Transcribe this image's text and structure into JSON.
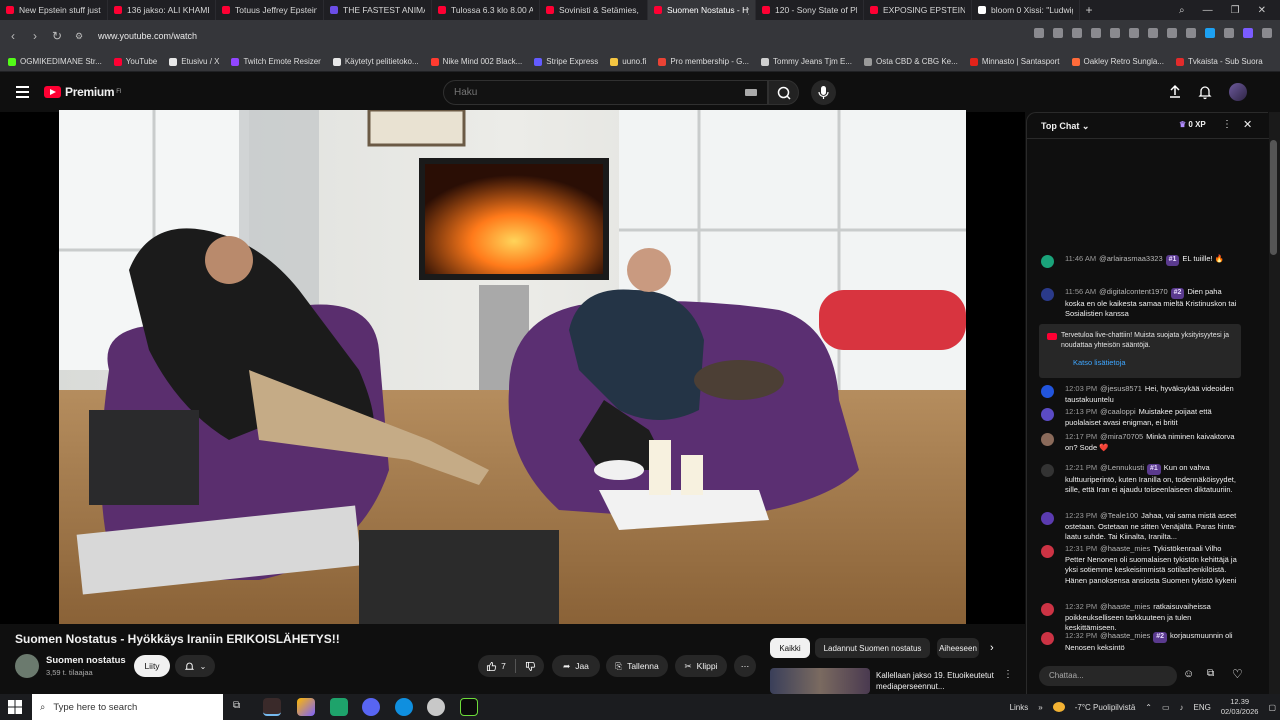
{
  "browser": {
    "tabs": [
      {
        "label": "New Epstein stuff just dr",
        "color": "#ff0033"
      },
      {
        "label": "136 jakso: ALI KHAMENE",
        "color": "#ff0033"
      },
      {
        "label": "Totuus Jeffrey Epsteinin",
        "color": "#ff0033"
      },
      {
        "label": "THE FASTEST ANIMATRO",
        "color": "#6b4de6"
      },
      {
        "label": "Tulossa 6.3 klo 8.00 Alek",
        "color": "#ff0033"
      },
      {
        "label": "Sovinisti & Setämies, jak",
        "color": "#ff0033"
      },
      {
        "label": "Suomen Nostatus - Hy",
        "color": "#ff0033",
        "active": true
      },
      {
        "label": "120 - Sony State of Play 2",
        "color": "#ff0033"
      },
      {
        "label": "EXPOSING EPSTEIN'S ZO",
        "color": "#ff0033"
      },
      {
        "label": "bloom 0 Xissi: \"Ludwig",
        "color": "#ffffff"
      }
    ],
    "url": "www.youtube.com/watch",
    "bookmarks": [
      {
        "label": "OGMIKEDIMANE Str...",
        "color": "#53fc18"
      },
      {
        "label": "YouTube",
        "color": "#ff0033"
      },
      {
        "label": "Etusivu / X",
        "color": "#e7e7e7"
      },
      {
        "label": "Twitch Emote Resizer",
        "color": "#9146ff"
      },
      {
        "label": "Käytetyt pelitietoko...",
        "color": "#e7e7e7"
      },
      {
        "label": "Nike Mind 002 Black...",
        "color": "#ff3b30"
      },
      {
        "label": "Stripe Express",
        "color": "#635bff"
      },
      {
        "label": "uuno.fi",
        "color": "#f4c542"
      },
      {
        "label": "Pro membership - G...",
        "color": "#ea4335"
      },
      {
        "label": "Tommy Jeans Tjm E...",
        "color": "#cfcfcf"
      },
      {
        "label": "Osta CBD & CBG Ke...",
        "color": "#9a9a9a"
      },
      {
        "label": "Minnasto | Santasport",
        "color": "#e2231a"
      },
      {
        "label": "Oakley Retro Sungla...",
        "color": "#ff6b3a"
      },
      {
        "label": "Tvkaista - Sub Suora",
        "color": "#e22b2b"
      }
    ]
  },
  "header": {
    "logo_text": "Premium",
    "logo_sup": "FI",
    "search_placeholder": "Haku"
  },
  "video": {
    "title": "Suomen Nostatus - Hyökkäys Iraniin ERIKOISLÄHETYS!!",
    "channel_name": "Suomen nostatus",
    "subscribers": "3,59 t. tilaajaa",
    "join_label": "Liity",
    "likes": "7",
    "share_label": "Jaa",
    "save_label": "Tallenna",
    "clip_label": "Klippi"
  },
  "chips": {
    "all": "Kaikki",
    "second": "Ladannut Suomen nostatus",
    "third": "Aiheeseen"
  },
  "recommended": {
    "title": "Kallellaan jakso 19. Etuoikeutetut mediaperseennut..."
  },
  "chat": {
    "mode": "Top Chat",
    "xp": "0 XP",
    "messages": [
      {
        "time": "11:46 AM",
        "author": "@arlairasmaa3323",
        "badge": "#1",
        "text": "EL tuiille! 🔥",
        "avatar": "#1aa37a"
      },
      {
        "time": "11:56 AM",
        "author": "@digitalcontent1970",
        "badge": "#2",
        "text": "Dien paha koska en ole kaikesta samaa mieltä Kristinuskon tai Sosialistien kanssa",
        "avatar": "#2a3a8a"
      },
      {
        "time": "12:03 PM",
        "author": "@jesus8571",
        "badge": "",
        "text": "Hei, hyväksykää videoiden taustakuuntelu",
        "avatar": "#2255dd"
      },
      {
        "time": "12:13 PM",
        "author": "@caaloppi",
        "badge": "",
        "text": "Muistakee poijaat että puolalaiset avasi enigman, ei britit",
        "avatar": "#5b4bc4"
      },
      {
        "time": "12:17 PM",
        "author": "@mira70705",
        "badge": "",
        "text": "Minkä niminen kaivaktorva on? Sode ❤️",
        "avatar": "#8a6a5a"
      },
      {
        "time": "12:21 PM",
        "author": "@Lennukusti",
        "badge": "#1",
        "text": "Kun on vahva kulttuuriperintö, kuten Iranilla on, todennäköisyydet, sille, että Iran ei ajaudu toiseenlaiseen diktatuuriin.",
        "avatar": "#333333"
      },
      {
        "time": "12:23 PM",
        "author": "@Teale100",
        "badge": "",
        "text": "Jahaa, vai sama mistä aseet ostetaan. Ostetaan ne sitten Venäjältä. Paras hinta-laatu suhde. Tai Kiinalta, Iranilta...",
        "avatar": "#5b3bb0"
      },
      {
        "time": "12:31 PM",
        "author": "@haaste_mies",
        "badge": "",
        "text": "Tykistökenraali Vilho Petter Nenonen oli suomalaisen tykistön kehittäjä ja yksi sotiemme keskeisimmistä sotilashenkilöistä. Hänen panoksensa ansiosta Suomen tykistö kykeni",
        "avatar": "#cc3344"
      },
      {
        "time": "12:32 PM",
        "author": "@haaste_mies",
        "badge": "",
        "text": "ratkaisuvaiheissa poikkeukselliseen tarkkuuteen ja tulen keskittämiseen.",
        "avatar": "#cc3344"
      },
      {
        "time": "12:32 PM",
        "author": "@haaste_mies",
        "badge": "#2",
        "text": "korjausmuunnin oli Nenosen keksintö",
        "avatar": "#cc3344"
      }
    ],
    "system_message": "Tervetuloa live-chattiin! Muista suojata yksityisyytesi ja noudattaa yhteisön sääntöjä.",
    "system_link": "Katso lisätietoja",
    "input_placeholder": "Chattaa..."
  },
  "taskbar": {
    "search_placeholder": "Type here to search",
    "links_label": "Links",
    "weather": "-7°C  Puolipilvistä",
    "language": "ENG",
    "time": "12.39",
    "date": "02/03/2026"
  }
}
